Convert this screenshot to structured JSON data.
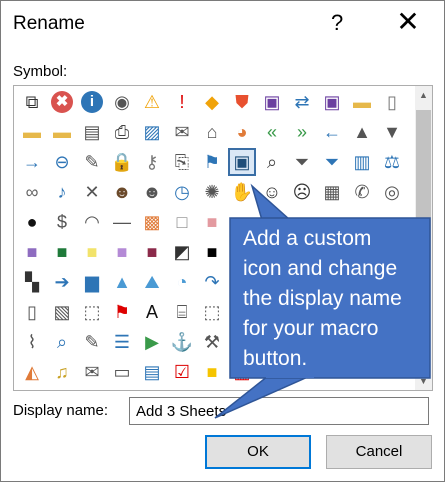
{
  "dialog": {
    "title": "Rename",
    "help_glyph": "?",
    "close_glyph": "✕"
  },
  "symbol": {
    "label": "Symbol:",
    "selected_icon": "window-icon",
    "icons": [
      [
        "org-chart-icon",
        "error-icon",
        "info-icon",
        "stop-icon",
        "warning-icon",
        "exclamation-icon",
        "diamond-warning-icon",
        "shield-icon",
        "save-icon",
        "swap-icon",
        "save-dropdown-icon",
        "folder-icon",
        "blank-page-icon"
      ],
      [
        "open-folder-icon",
        "folder-open-icon",
        "address-icon",
        "printer-icon",
        "picture-icon",
        "envelope-pin-icon",
        "home-icon",
        "pie-chart-icon",
        "left-arrows-icon",
        "right-arrows-icon",
        "left-arrow-icon",
        "up-triangle-icon",
        "down-triangle-icon"
      ],
      [
        "right-arrow-icon",
        "circle-arrow-icon",
        "pin-icon",
        "lock-icon",
        "key-icon",
        "scroll-icon",
        "flag-icon",
        "window-icon",
        "magnifier-icon",
        "filter-icon",
        "filter-funnel-icon",
        "book-icon",
        "scales-icon"
      ],
      [
        "rings-icon",
        "microphone-icon",
        "mute-icon",
        "person-icon",
        "people-icon",
        "clock-icon",
        "sparkle-icon",
        "hand-icon",
        "smile-icon",
        "sad-icon",
        "calculator-icon",
        "phone-icon",
        "piggy-bank-icon"
      ],
      [
        "eight-ball-icon",
        "dollar-icon",
        "eye-icon",
        "dash-icon",
        "mosaic-icon",
        "white-square-icon",
        "pink-square-icon",
        "blank-icon",
        "blank-icon",
        "blank-icon",
        "blank-icon",
        "blank-icon",
        "blank-icon"
      ],
      [
        "purple-square-icon",
        "green-square-icon",
        "yellow-square-icon",
        "violet-square-icon",
        "maroon-square-icon",
        "half-square-icon",
        "black-square-icon",
        "red-square-icon",
        "blank-icon",
        "blank-icon",
        "blank-icon",
        "blank-icon",
        "blank-icon"
      ],
      [
        "checker-icon",
        "arrow-circle-icon",
        "bar-chart-icon",
        "cone-icon",
        "mountain-icon",
        "pie-icon",
        "curved-arrow-icon",
        "blank-icon",
        "blank-icon",
        "blank-icon",
        "blank-icon",
        "blank-icon",
        "blank-icon"
      ],
      [
        "page-icon",
        "image-frame-icon",
        "dotted-frame-icon",
        "ribbon-icon",
        "letter-a-icon",
        "toolbox-icon",
        "dotted-box-icon",
        "blank-icon",
        "blank-icon",
        "blank-icon",
        "blank-icon",
        "blank-icon",
        "blank-icon"
      ],
      [
        "paint-icon",
        "search-icon",
        "broom-icon",
        "list-icon",
        "play-icon",
        "anchor-icon",
        "tools-icon",
        "plug-icon",
        "blank-icon",
        "blank-icon",
        "blank-icon",
        "blank-icon",
        "blank-icon"
      ],
      [
        "office-logo-icon",
        "bell-icon",
        "open-envelope-icon",
        "card-icon",
        "id-card-icon",
        "check-doc-icon",
        "yellow-block-icon",
        "striped-block-icon",
        "blank-icon",
        "blank-icon",
        "blank-icon",
        "blank-icon",
        "blank-icon"
      ]
    ]
  },
  "callout": {
    "text_lines": [
      "Add a custom",
      "icon and change",
      "the display name",
      "for your macro",
      "button."
    ]
  },
  "display_name": {
    "label": "Display name:",
    "value": "Add 3 Sheets"
  },
  "buttons": {
    "ok": "OK",
    "cancel": "Cancel"
  },
  "colors": {
    "callout_fill": "#4472c4",
    "callout_border": "#2f5597",
    "accent": "#0078d7"
  }
}
